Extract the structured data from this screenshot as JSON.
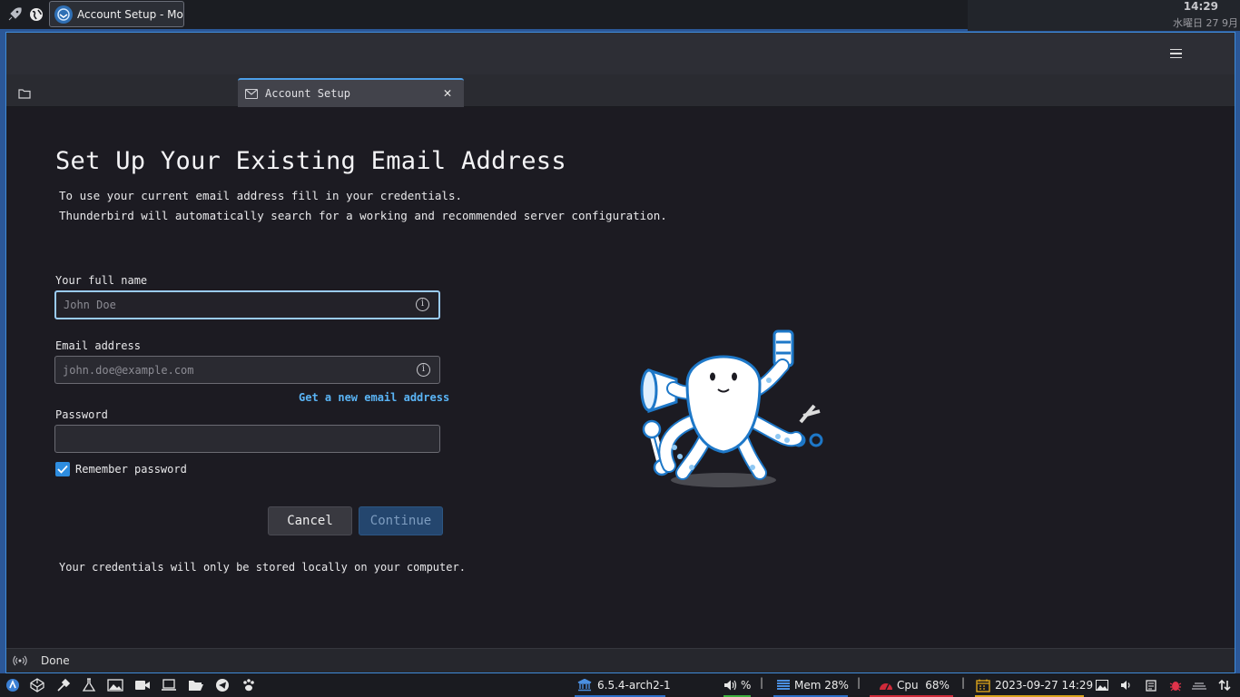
{
  "top_panel": {
    "task_title": "Account Setup - Mo...",
    "clock_time": "14:29",
    "clock_date": "水曜日 27 9月"
  },
  "window": {
    "tab": {
      "label": "Account Setup",
      "close_glyph": "✕"
    },
    "page": {
      "title": "Set Up Your Existing Email Address",
      "description_line1": "To use your current email address fill in your credentials.",
      "description_line2": "Thunderbird will automatically search for a working and recommended server configuration.",
      "full_name": {
        "label": "Your full name",
        "value": "",
        "placeholder": "John Doe"
      },
      "email": {
        "label": "Email address",
        "value": "",
        "placeholder": "john.doe@example.com"
      },
      "get_new_email_link": "Get a new email address",
      "password": {
        "label": "Password",
        "value": ""
      },
      "remember_password": {
        "label": "Remember password",
        "checked": true
      },
      "cancel_label": "Cancel",
      "continue_label": "Continue",
      "credentials_note": "Your credentials will only be stored locally on your computer."
    },
    "status": {
      "text": "Done"
    }
  },
  "bottom_panel": {
    "kernel": "6.5.4-arch2-1",
    "volume": "%",
    "mem": "Mem 28%",
    "cpu": "Cpu  68%",
    "datetime": "2023-09-27 14:29",
    "separator": "|"
  },
  "colors": {
    "accent": "#4c9fe8",
    "link": "#5ab4f5",
    "continue_disabled": "#24466e",
    "mem_bar": "#2d6ec8",
    "cpu_bar": "#d02a3a",
    "date_bar": "#d9a21b",
    "kernel_bar": "#2d6ec8",
    "volume_bar": "#3fae3f"
  },
  "icons": {
    "launcher": "rocket-icon",
    "browser": "globe-icon",
    "thunderbird": "thunderbird-icon",
    "menu": "hamburger-menu-icon",
    "folder_tab": "folder-icon",
    "mail": "envelope-icon",
    "info": "info-icon",
    "status": "wifi-signal-icon",
    "mascot": "octopus-mascot-icon"
  }
}
